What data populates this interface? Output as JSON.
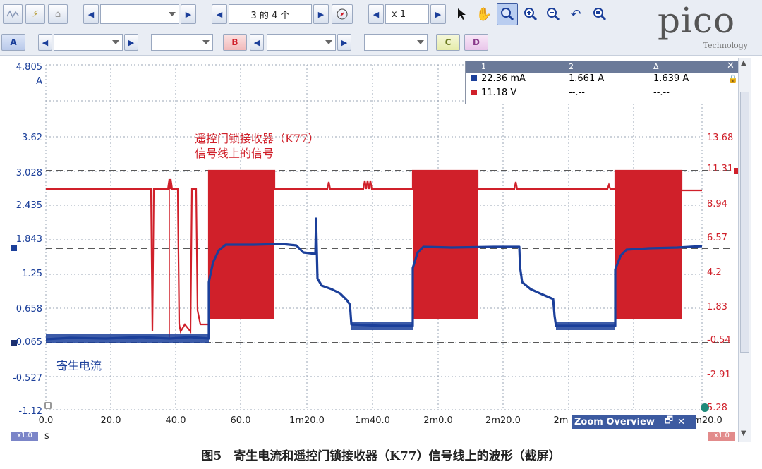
{
  "toolbar": {
    "page_indicator": "3 的 4 个",
    "zoom_factor": "x 1"
  },
  "channels": {
    "a": "A",
    "b": "B",
    "c": "C",
    "d": "D"
  },
  "logo": {
    "main": "pico",
    "sub": "Technology"
  },
  "measurements": {
    "headers": [
      "1",
      "2",
      "Δ"
    ],
    "rows": [
      {
        "v1": "22.36 mA",
        "v2": "1.661 A",
        "v3": "1.639 A"
      },
      {
        "v1": "11.18 V",
        "v2": "--.--",
        "v3": "--.--"
      }
    ]
  },
  "axes": {
    "left_unit": "A",
    "left_ticks": [
      "4.805",
      "3.62",
      "3.028",
      "2.435",
      "1.843",
      "1.25",
      "0.658",
      "0.065",
      "-0.527",
      "-1.12"
    ],
    "right_ticks": [
      "13.68",
      "11.31",
      "8.94",
      "6.57",
      "4.2",
      "1.83",
      "-0.54",
      "-2.91",
      "5.28"
    ],
    "x_ticks": [
      "0.0",
      "20.0",
      "40.0",
      "60.0",
      "1m20.0",
      "1m40.0",
      "2m0.0",
      "2m20.0",
      "2m",
      "m20.0"
    ],
    "x_unit": "s",
    "x_multiplier": "x1.0"
  },
  "annotations": {
    "red_line1": "遥控门锁接收器（K77）",
    "red_line2": "信号线上的信号",
    "blue": "寄生电流"
  },
  "zoom_overview": {
    "title": "Zoom Overview"
  },
  "caption": "图5　寄生电流和遥控门锁接收器（K77）信号线上的波形（截屏）",
  "colors": {
    "channel_a": "#1b3f9a",
    "channel_b": "#d0202a",
    "grid": "#9aa4b4"
  }
}
